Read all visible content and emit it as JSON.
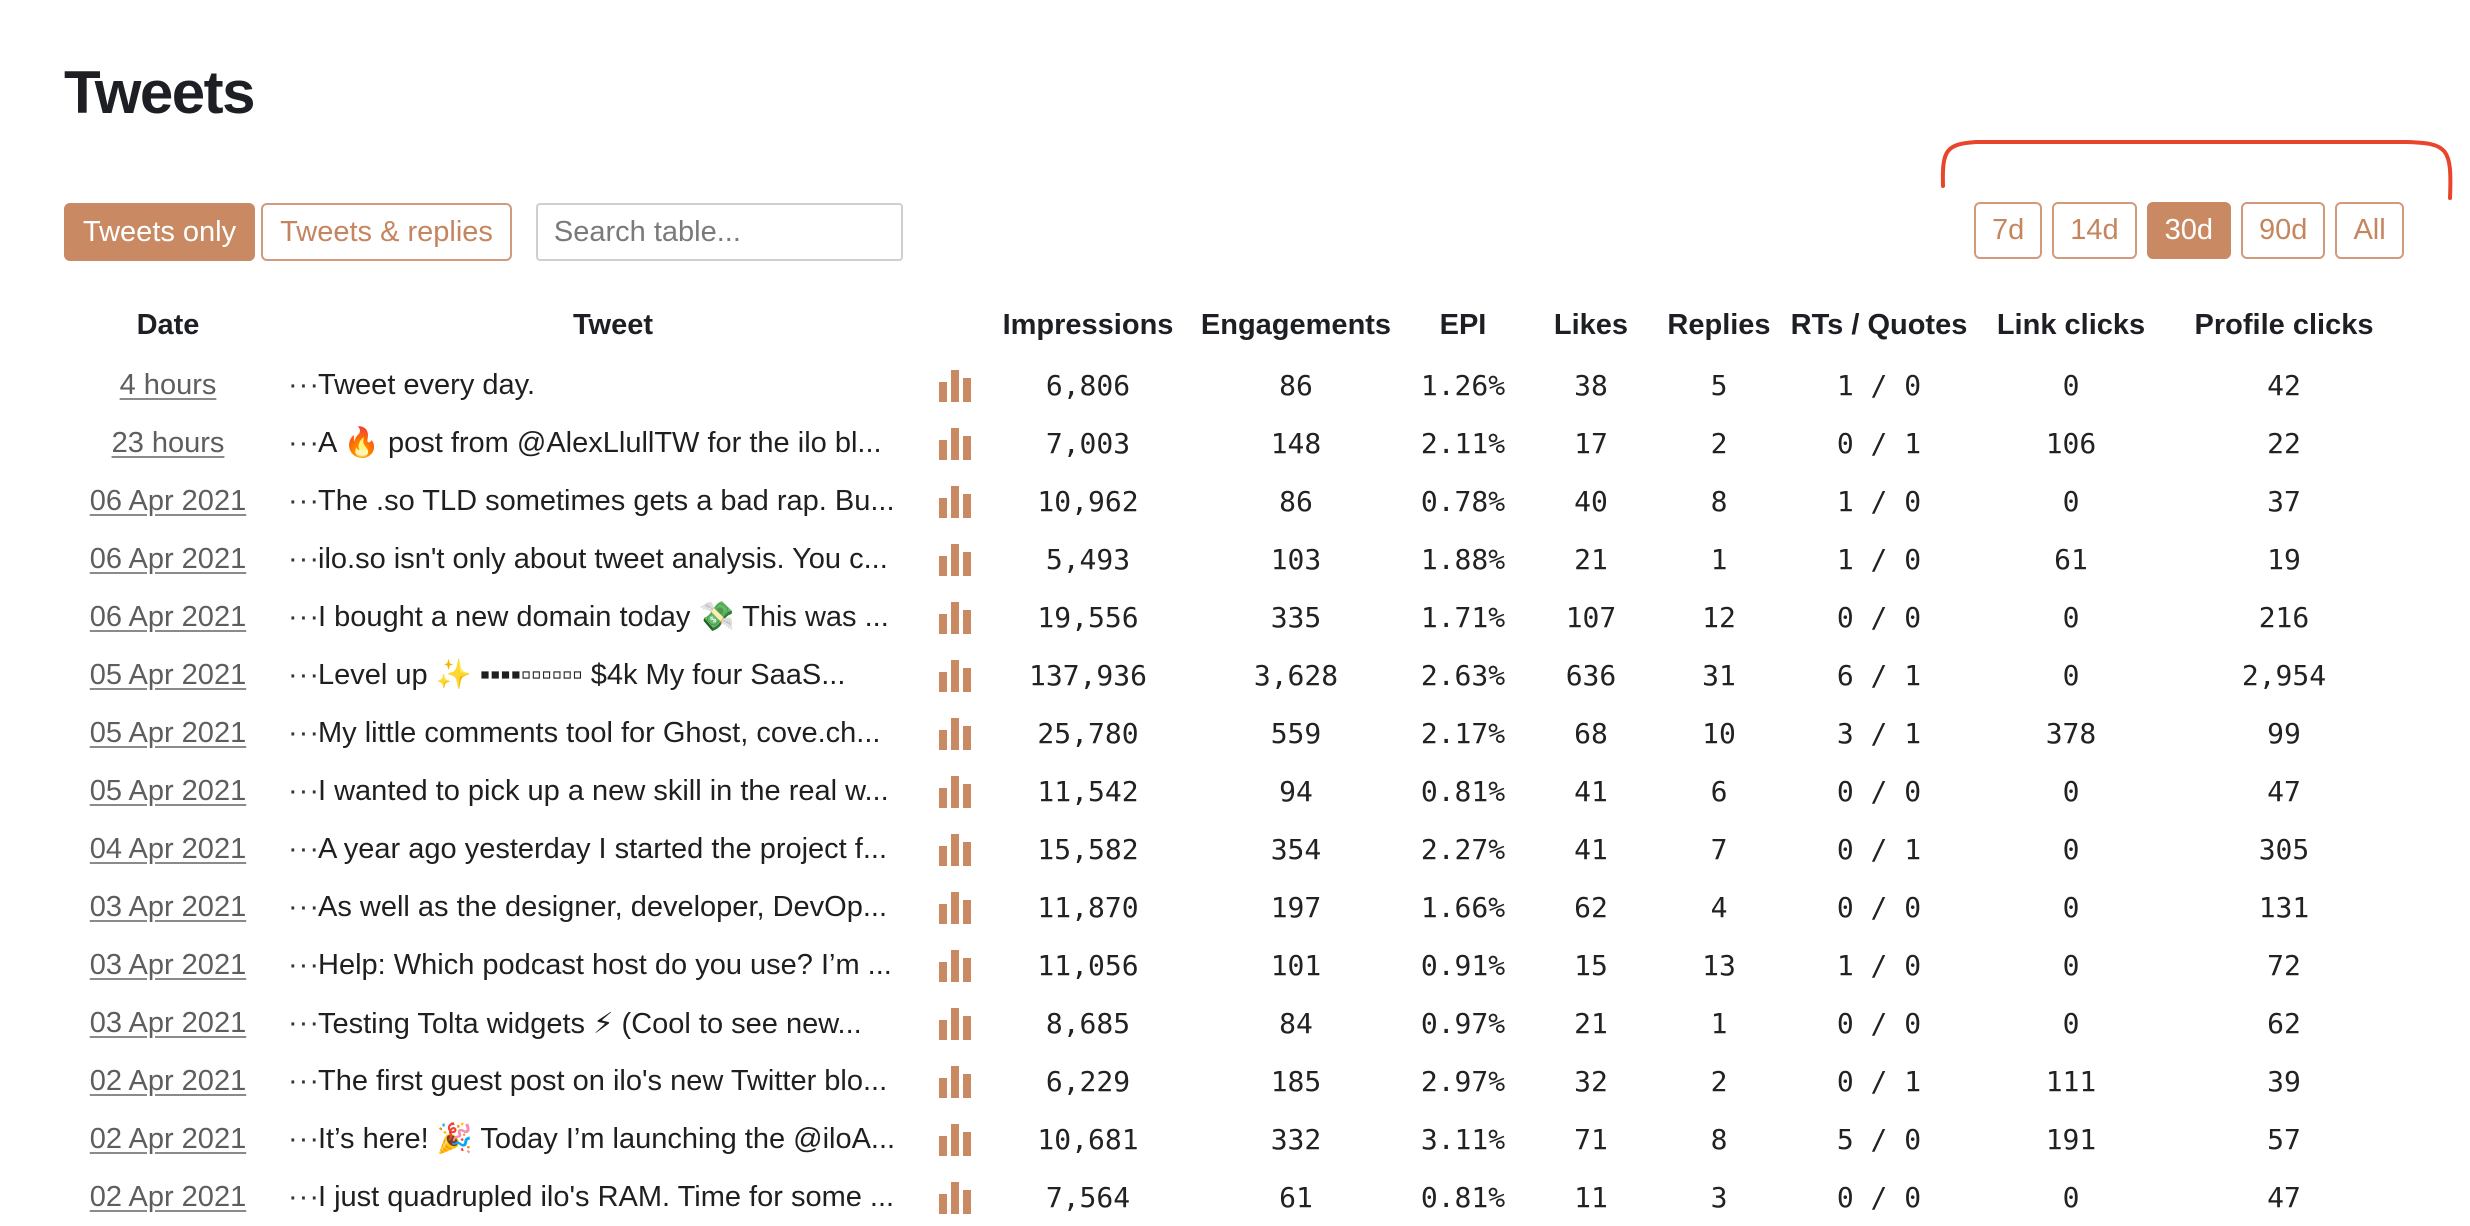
{
  "page": {
    "title": "Tweets"
  },
  "filters": {
    "tweets_only": "Tweets only",
    "tweets_replies": "Tweets & replies",
    "search_placeholder": "Search table..."
  },
  "ranges": {
    "d7": "7d",
    "d14": "14d",
    "d30": "30d",
    "d90": "90d",
    "all": "All",
    "active": "30d"
  },
  "colors": {
    "accent": "#c98a63",
    "annotation": "#e8452c"
  },
  "table": {
    "headers": {
      "date": "Date",
      "tweet": "Tweet",
      "impressions": "Impressions",
      "engagements": "Engagements",
      "epi": "EPI",
      "likes": "Likes",
      "replies": "Replies",
      "rts": "RTs / Quotes",
      "link_clicks": "Link clicks",
      "profile_clicks": "Profile clicks"
    },
    "more_icon": "···",
    "rows": [
      {
        "date": "4 hours",
        "tweet": "Tweet every day.",
        "impressions": "6,806",
        "engagements": "86",
        "epi": "1.26%",
        "likes": "38",
        "replies": "5",
        "rts": "1 / 0",
        "link_clicks": "0",
        "profile_clicks": "42"
      },
      {
        "date": "23 hours",
        "tweet": "A 🔥 post from @AlexLlullTW for the ilo bl...",
        "impressions": "7,003",
        "engagements": "148",
        "epi": "2.11%",
        "likes": "17",
        "replies": "2",
        "rts": "0 / 1",
        "link_clicks": "106",
        "profile_clicks": "22"
      },
      {
        "date": "06 Apr 2021",
        "tweet": "The .so TLD sometimes gets a bad rap. Bu...",
        "impressions": "10,962",
        "engagements": "86",
        "epi": "0.78%",
        "likes": "40",
        "replies": "8",
        "rts": "1 / 0",
        "link_clicks": "0",
        "profile_clicks": "37"
      },
      {
        "date": "06 Apr 2021",
        "tweet": "ilo.so isn't only about tweet analysis. You c...",
        "impressions": "5,493",
        "engagements": "103",
        "epi": "1.88%",
        "likes": "21",
        "replies": "1",
        "rts": "1 / 0",
        "link_clicks": "61",
        "profile_clicks": "19"
      },
      {
        "date": "06 Apr 2021",
        "tweet": "I bought a new domain today 💸 This was ...",
        "impressions": "19,556",
        "engagements": "335",
        "epi": "1.71%",
        "likes": "107",
        "replies": "12",
        "rts": "0 / 0",
        "link_clicks": "0",
        "profile_clicks": "216"
      },
      {
        "date": "05 Apr 2021",
        "tweet": "Level up ✨ ▪▪▪▪▫▫▫▫▫▫ $4k My four SaaS...",
        "impressions": "137,936",
        "engagements": "3,628",
        "epi": "2.63%",
        "likes": "636",
        "replies": "31",
        "rts": "6 / 1",
        "link_clicks": "0",
        "profile_clicks": "2,954"
      },
      {
        "date": "05 Apr 2021",
        "tweet": "My little comments tool for Ghost, cove.ch...",
        "impressions": "25,780",
        "engagements": "559",
        "epi": "2.17%",
        "likes": "68",
        "replies": "10",
        "rts": "3 / 1",
        "link_clicks": "378",
        "profile_clicks": "99"
      },
      {
        "date": "05 Apr 2021",
        "tweet": "I wanted to pick up a new skill in the real w...",
        "impressions": "11,542",
        "engagements": "94",
        "epi": "0.81%",
        "likes": "41",
        "replies": "6",
        "rts": "0 / 0",
        "link_clicks": "0",
        "profile_clicks": "47"
      },
      {
        "date": "04 Apr 2021",
        "tweet": "A year ago yesterday I started the project f...",
        "impressions": "15,582",
        "engagements": "354",
        "epi": "2.27%",
        "likes": "41",
        "replies": "7",
        "rts": "0 / 1",
        "link_clicks": "0",
        "profile_clicks": "305"
      },
      {
        "date": "03 Apr 2021",
        "tweet": "As well as the designer, developer, DevOp...",
        "impressions": "11,870",
        "engagements": "197",
        "epi": "1.66%",
        "likes": "62",
        "replies": "4",
        "rts": "0 / 0",
        "link_clicks": "0",
        "profile_clicks": "131"
      },
      {
        "date": "03 Apr 2021",
        "tweet": "Help: Which podcast host do you use? I’m ...",
        "impressions": "11,056",
        "engagements": "101",
        "epi": "0.91%",
        "likes": "15",
        "replies": "13",
        "rts": "1 / 0",
        "link_clicks": "0",
        "profile_clicks": "72"
      },
      {
        "date": "03 Apr 2021",
        "tweet": "Testing Tolta widgets ⚡ (Cool to see new...",
        "impressions": "8,685",
        "engagements": "84",
        "epi": "0.97%",
        "likes": "21",
        "replies": "1",
        "rts": "0 / 0",
        "link_clicks": "0",
        "profile_clicks": "62"
      },
      {
        "date": "02 Apr 2021",
        "tweet": "The first guest post on ilo's new Twitter blo...",
        "impressions": "6,229",
        "engagements": "185",
        "epi": "2.97%",
        "likes": "32",
        "replies": "2",
        "rts": "0 / 1",
        "link_clicks": "111",
        "profile_clicks": "39"
      },
      {
        "date": "02 Apr 2021",
        "tweet": "It’s here! 🎉 Today I’m launching the @iloA...",
        "impressions": "10,681",
        "engagements": "332",
        "epi": "3.11%",
        "likes": "71",
        "replies": "8",
        "rts": "5 / 0",
        "link_clicks": "191",
        "profile_clicks": "57"
      },
      {
        "date": "02 Apr 2021",
        "tweet": "I just quadrupled ilo's RAM. Time for some ...",
        "impressions": "7,564",
        "engagements": "61",
        "epi": "0.81%",
        "likes": "11",
        "replies": "3",
        "rts": "0 / 0",
        "link_clicks": "0",
        "profile_clicks": "47"
      }
    ]
  }
}
